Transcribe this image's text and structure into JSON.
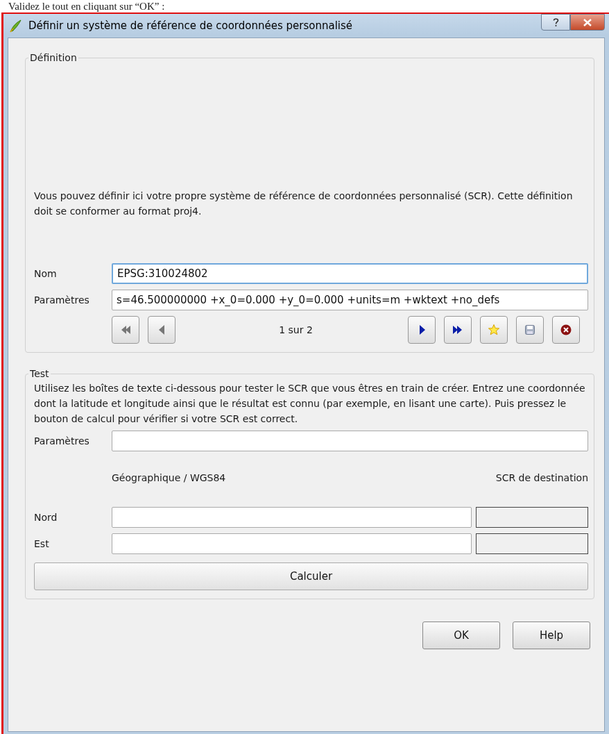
{
  "caption": "Validez le tout en cliquant sur “OK” :",
  "window": {
    "title": "Définir un système de référence de coordonnées personnalisé"
  },
  "definition": {
    "title": "Définition",
    "description": "Vous pouvez définir ici votre propre système de référence de coordonnées personnalisé (SCR). Cette définition doit se conformer au format proj4.",
    "name_label": "Nom",
    "name_value": "EPSG:310024802",
    "params_label": "Paramètres",
    "params_value": "s=46.500000000 +x_0=0.000 +y_0=0.000 +units=m +wktext +no_defs",
    "pager": "1 sur 2",
    "nav_buttons": [
      {
        "kind": "first",
        "disabled": true
      },
      {
        "kind": "prev",
        "disabled": true
      }
    ],
    "tool_buttons": [
      {
        "kind": "next",
        "disabled": false
      },
      {
        "kind": "last",
        "disabled": false
      },
      {
        "kind": "add",
        "disabled": false
      },
      {
        "kind": "save",
        "disabled": true
      },
      {
        "kind": "remove",
        "disabled": false
      }
    ]
  },
  "test": {
    "title": "Test",
    "description": "Utilisez les boîtes de texte ci-dessous pour tester le SCR que vous êtres en train de créer. Entrez une coordonnée dont la latitude et longitude ainsi que le résultat est connu (par exemple, en lisant une carte). Puis pressez le bouton de calcul pour vérifier si votre SCR est correct.",
    "params_label": "Paramètres",
    "geo_header": "Géographique / WGS84",
    "dest_header": "SCR de destination",
    "rows": [
      {
        "label": "Nord"
      },
      {
        "label": "Est"
      }
    ],
    "calc_button": "Calculer"
  },
  "buttons": [
    "OK",
    "Help"
  ]
}
